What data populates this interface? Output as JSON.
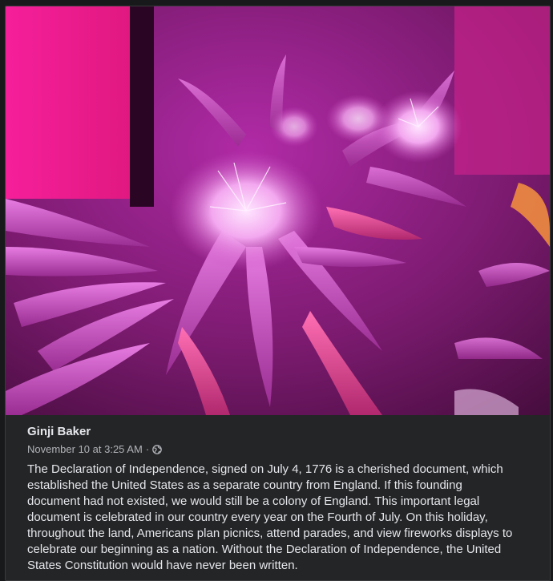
{
  "post": {
    "author": "Ginji Baker",
    "timestamp": "November 10 at 3:25 AM",
    "separator": "·",
    "audience_icon": "globe-icon",
    "text": "The Declaration of Independence, signed on July 4, 1776 is a cherished document, which established the United States as a separate country from England. If this founding document had not existed, we would still be a colony of England. This important legal document is celebrated in our country every year on the Fourth of July. On this holiday, throughout the land, Americans plan picnics, attend parades, and view fireworks displays to celebrate our beginning as a nation. Without the Declaration of Independence, the United States Constitution would have never been written."
  },
  "colors": {
    "page_background": "#18191a",
    "card_background": "#242526",
    "primary_text": "#e4e6eb",
    "secondary_text": "#b0b3b8",
    "photo_magenta": "#d236c8",
    "photo_pink": "#f21a9a"
  }
}
